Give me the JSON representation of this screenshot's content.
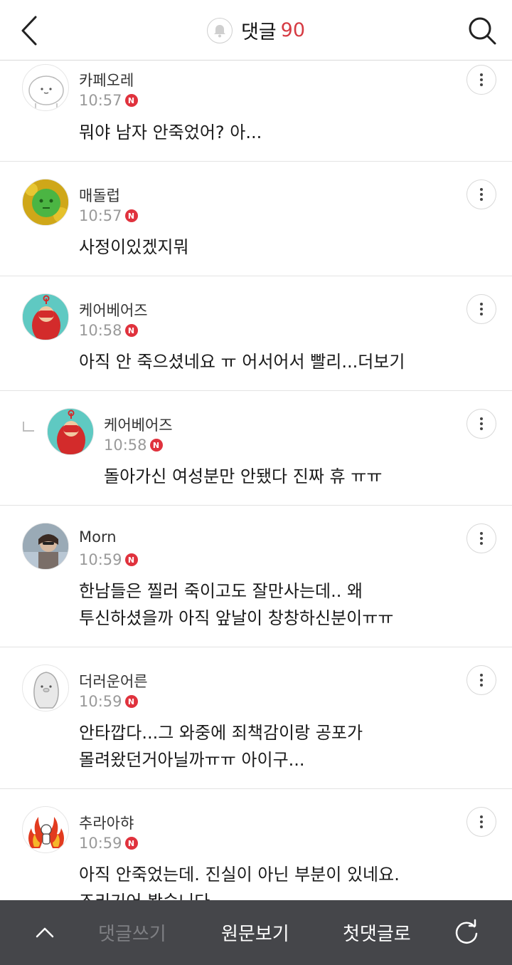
{
  "header": {
    "title": "댓글",
    "count": "90"
  },
  "comments": [
    {
      "nick": "카페오레",
      "time": "10:57",
      "badge": "N",
      "text": "뭐야 남자 안죽었어? 아..."
    },
    {
      "nick": "매돌럽",
      "time": "10:57",
      "badge": "N",
      "text": "사정이있겠지뭐"
    },
    {
      "nick": "케어베어즈",
      "time": "10:58",
      "badge": "N",
      "text": "아직 안 죽으셨네요 ㅠ 어서어서 빨리...더보기"
    },
    {
      "nick": "케어베어즈",
      "time": "10:58",
      "badge": "N",
      "text": "돌아가신 여성분만 안됐다 진짜 휴 ㅠㅠ"
    },
    {
      "nick": "Morn",
      "time": "10:59",
      "badge": "N",
      "text": "한남들은 찔러 죽이고도 잘만사는데.. 왜\n투신하셨을까 아직 앞날이 창창하신분이ㅠㅠ"
    },
    {
      "nick": "더러운어른",
      "time": "10:59",
      "badge": "N",
      "text": "안타깝다...그 와중에 죄책감이랑 공포가\n몰려왔던거아닐까ㅠㅠ 아이구..."
    },
    {
      "nick": "추라아햐",
      "time": "10:59",
      "badge": "N",
      "text": "아직 안죽었는데. 진실이 아닌 부분이 있네요.\n조리기어 봤습니다"
    }
  ],
  "footer": {
    "write": "댓글쓰기",
    "original": "원문보기",
    "first": "첫댓글로"
  },
  "colors": {
    "accent": "#d63b43",
    "badge": "#e0323d",
    "footer_bg": "#45464a"
  },
  "icons": [
    "back-arrow-icon",
    "bell-icon",
    "search-icon",
    "more-vertical-icon",
    "chevron-up-icon",
    "refresh-icon"
  ]
}
